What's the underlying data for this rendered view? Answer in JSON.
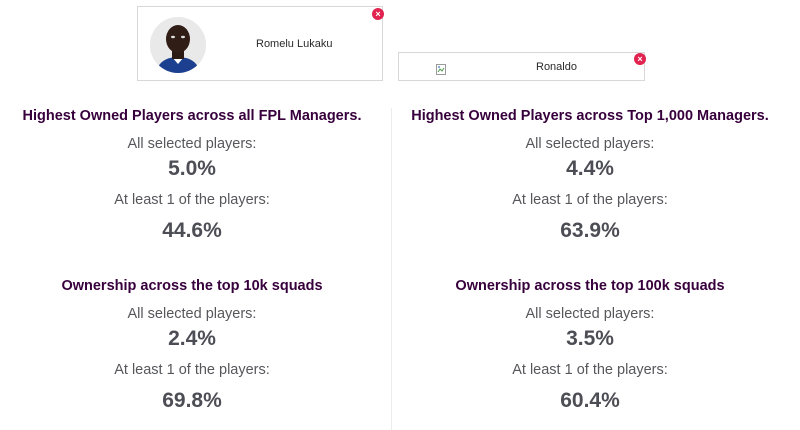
{
  "selected_players": [
    {
      "name": "Romelu Lukaku",
      "remove_icon": "close-icon"
    },
    {
      "name": "Ronaldo",
      "remove_icon": "close-icon",
      "image": "broken-image-icon"
    }
  ],
  "stats": {
    "all_managers": {
      "title": "Highest Owned Players across all FPL Managers.",
      "all_label": "All selected players:",
      "all_value": "5.0%",
      "atleast_label": "At least 1 of the players:",
      "atleast_value": "44.6%"
    },
    "top_1000": {
      "title": "Highest Owned Players across Top 1,000 Managers.",
      "all_label": "All selected players:",
      "all_value": "4.4%",
      "atleast_label": "At least 1 of the players:",
      "atleast_value": "63.9%"
    },
    "top_10k": {
      "title": "Ownership across the top 10k squads",
      "all_label": "All selected players:",
      "all_value": "2.4%",
      "atleast_label": "At least 1 of the players:",
      "atleast_value": "69.8%"
    },
    "top_100k": {
      "title": "Ownership across the top 100k squads",
      "all_label": "All selected players:",
      "all_value": "3.5%",
      "atleast_label": "At least 1 of the players:",
      "atleast_value": "60.4%"
    }
  },
  "colors": {
    "title": "#37003c",
    "value": "#4d4d55",
    "label": "#56575b",
    "remove": "#e0234f"
  }
}
